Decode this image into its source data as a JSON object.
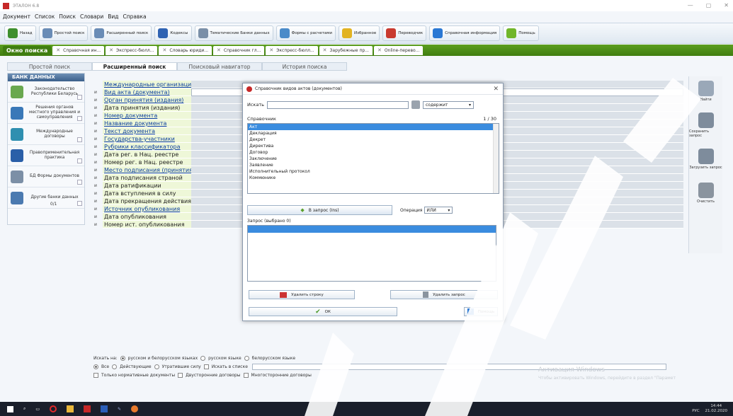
{
  "window": {
    "title": "ЭТАЛОН 6.8",
    "controls": [
      "—",
      "▢",
      "✕"
    ]
  },
  "menu": [
    "Документ",
    "Список",
    "Поиск",
    "Словари",
    "Вид",
    "Справка"
  ],
  "toolbar": [
    {
      "label": "Назад",
      "icon": "back-icon",
      "color": "#3e8f2d"
    },
    {
      "label": "Простой поиск",
      "icon": "search-icon",
      "color": "#6a8cb6"
    },
    {
      "label": "Расширенный поиск",
      "icon": "search-icon",
      "color": "#6a8cb6"
    },
    {
      "label": "Кодексы",
      "icon": "book-icon",
      "color": "#2f63b3"
    },
    {
      "label": "Тематические Банки данных",
      "icon": "folder-icon",
      "color": "#7a8fa8"
    },
    {
      "label": "Формы с расчетами",
      "icon": "form-icon",
      "color": "#4a8bc9"
    },
    {
      "label": "Избранное",
      "icon": "star-icon",
      "color": "#e2b322"
    },
    {
      "label": "Переводчик",
      "icon": "translate-icon",
      "color": "#c93a2f"
    },
    {
      "label": "Справочная информация",
      "icon": "info-icon",
      "color": "#2a78d4"
    },
    {
      "label": "Помощь",
      "icon": "help-icon",
      "color": "#71b62a"
    }
  ],
  "tabs": [
    {
      "label": "Окно поиска",
      "active": true
    },
    {
      "label": "Справочная ин...",
      "active": false
    },
    {
      "label": "Экспресс-бюлл...",
      "active": false
    },
    {
      "label": "Словарь юриди...",
      "active": false
    },
    {
      "label": "Справочник гл...",
      "active": false
    },
    {
      "label": "Экспресс-бюлл...",
      "active": false
    },
    {
      "label": "Зарубежные пр...",
      "active": false
    },
    {
      "label": "Online-перево...",
      "active": false
    }
  ],
  "subtabs": [
    {
      "label": "Простой поиск",
      "active": false
    },
    {
      "label": "Расширенный поиск",
      "active": true
    },
    {
      "label": "Поисковый навигатор",
      "active": false
    },
    {
      "label": "История поиска",
      "active": false
    }
  ],
  "left_panel": {
    "header": "БАНК ДАННЫХ",
    "items": [
      {
        "label": "Законодательство Республики Беларусь",
        "icon": "belarus-map-icon",
        "color": "#6aa84f"
      },
      {
        "label": "Решения органов местного управления и самоуправления",
        "icon": "building-icon",
        "color": "#3a78b8"
      },
      {
        "label": "Международные договоры",
        "icon": "world-map-icon",
        "color": "#2f8fb0"
      },
      {
        "label": "Правоприменительная практика",
        "icon": "scales-icon",
        "color": "#2a5fa8"
      },
      {
        "label": "БД Формы документов",
        "icon": "pen-icon",
        "color": "#7c8fa6"
      },
      {
        "label": "Другие банки данных",
        "icon": "gear-icon",
        "color": "#4b7ab0",
        "count": "0/1"
      }
    ]
  },
  "fields": [
    {
      "op": "",
      "label": "Международные организации",
      "link": true
    },
    {
      "op": "и",
      "label": "Вид акта (документа)",
      "link": true
    },
    {
      "op": "и",
      "label": "Орган принятия (издания)",
      "link": true
    },
    {
      "op": "и",
      "label": "Дата принятия (издания)",
      "link": false
    },
    {
      "op": "и",
      "label": "Номер документа",
      "link": true
    },
    {
      "op": "и",
      "label": "Название документа",
      "link": true
    },
    {
      "op": "и",
      "label": "Текст документа",
      "link": true
    },
    {
      "op": "и",
      "label": "Государства-участники",
      "link": true
    },
    {
      "op": "и",
      "label": "Рубрики классификатора",
      "link": true
    },
    {
      "op": "и",
      "label": "Дата рег. в Нац. реестре",
      "link": false
    },
    {
      "op": "и",
      "label": "Номер рег. в Нац. реестре",
      "link": false
    },
    {
      "op": "и",
      "label": "Место подписания (принятия)",
      "link": true
    },
    {
      "op": "и",
      "label": "Дата подписания страной",
      "link": false
    },
    {
      "op": "и",
      "label": "Дата ратификации",
      "link": false
    },
    {
      "op": "и",
      "label": "Дата вступления в силу",
      "link": false
    },
    {
      "op": "и",
      "label": "Дата прекращения действия",
      "link": false
    },
    {
      "op": "и",
      "label": "Источник опубликования",
      "link": true
    },
    {
      "op": "и",
      "label": "Дата опубликования",
      "link": false
    },
    {
      "op": "и",
      "label": "Номер ист. опубликования",
      "link": false
    }
  ],
  "right_panel": [
    {
      "label": "Найти",
      "icon": "magnifier-icon",
      "color": "#9aa8b8"
    },
    {
      "label": "Сохранить запрос",
      "icon": "save-query-icon",
      "color": "#7e8c9c"
    },
    {
      "label": "Загрузить запрос",
      "icon": "load-query-icon",
      "color": "#7e8c9c"
    },
    {
      "label": "Очистить",
      "icon": "trash-icon",
      "color": "#8a949f"
    }
  ],
  "bottom": {
    "search_in_label": "Искать на:",
    "lang_options": [
      {
        "label": "русском и белорусском языках",
        "checked": true
      },
      {
        "label": "русском языке",
        "checked": false
      },
      {
        "label": "белорусском языке",
        "checked": false
      }
    ],
    "status_options": [
      {
        "label": "Все",
        "checked": true
      },
      {
        "label": "Действующие",
        "checked": false
      },
      {
        "label": "Утратившие силу",
        "checked": false
      }
    ],
    "search_in_list": "Искать в списке",
    "checkboxes": [
      "Только нормативные документы",
      "Двусторонние договоры",
      "Многосторонние договоры"
    ]
  },
  "watermark": {
    "line1": "Активация Windows",
    "line2": "Чтобы активировать Windows, перейдите в раздел \"Парамет"
  },
  "dialog": {
    "title": "Справочник видов актов (документов)",
    "search_label": "Искать",
    "search_mode": "содержит",
    "list_label": "Справочник",
    "counter": "1 / 30",
    "items": [
      "Акт",
      "Декларация",
      "Декрет",
      "Директива",
      "Договор",
      "Заключение",
      "Заявление",
      "Исполнительный протокол",
      "Коммюнике"
    ],
    "add_button": "В запрос (Ins)",
    "operation_label": "Операция",
    "operation_value": "ИЛИ",
    "query_label": "Запрос (выбрано 0)",
    "delete_row": "Удалить строку",
    "delete_query": "Удалить запрос",
    "ok": "ОК",
    "help": "Помощь"
  },
  "taskbar": {
    "lang": "РУС",
    "time": "14:44",
    "date": "21.02.2020"
  }
}
